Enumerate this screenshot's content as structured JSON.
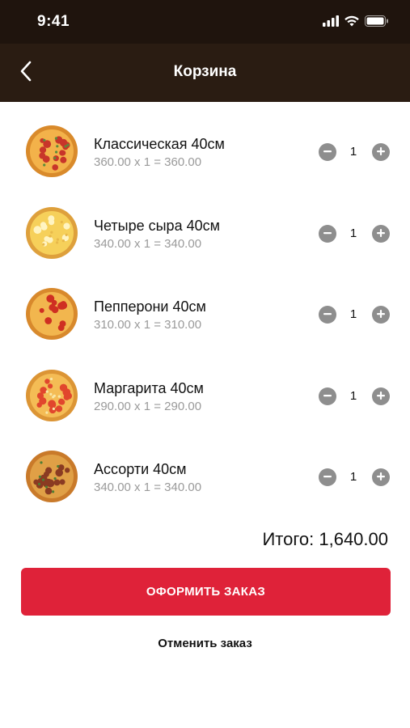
{
  "status_bar": {
    "time": "9:41",
    "icons": [
      "signal-icon",
      "wifi-icon",
      "battery-icon"
    ]
  },
  "nav": {
    "title": "Корзина",
    "back_icon": "chevron-left-icon"
  },
  "items": [
    {
      "name": "Классическая 40см",
      "price_line": "360.00 x 1 = 360.00",
      "qty": "1",
      "pizza": "classic"
    },
    {
      "name": "Четыре сыра 40см",
      "price_line": "340.00 x 1 = 340.00",
      "qty": "1",
      "pizza": "cheese"
    },
    {
      "name": "Пепперони 40см",
      "price_line": "310.00 x 1 = 310.00",
      "qty": "1",
      "pizza": "pepperoni"
    },
    {
      "name": "Маргарита 40см",
      "price_line": "290.00 x 1 = 290.00",
      "qty": "1",
      "pizza": "margherita"
    },
    {
      "name": "Ассорти 40см",
      "price_line": "340.00 x 1 = 340.00",
      "qty": "1",
      "pizza": "assorti"
    }
  ],
  "total": "Итого: 1,640.00",
  "checkout_label": "ОФОРМИТЬ ЗАКАЗ",
  "cancel_label": "Отменить заказ",
  "colors": {
    "status_bar_bg": "#1f140d",
    "nav_bg": "#2a1c12",
    "accent": "#df2239",
    "stepper": "#8e8e8e",
    "muted_text": "#9a9a9a"
  }
}
